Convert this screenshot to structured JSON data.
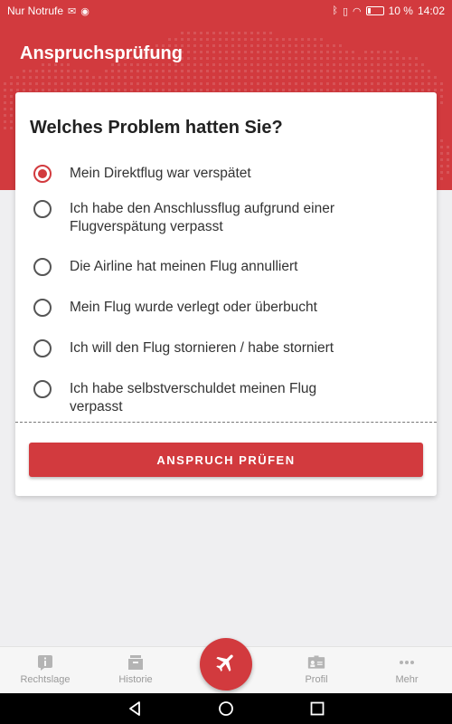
{
  "status_bar": {
    "carrier": "Nur Notrufe",
    "battery": "10 %",
    "time": "14:02"
  },
  "header": {
    "title": "Anspruchsprüfung"
  },
  "card": {
    "title": "Welches Problem hatten Sie?",
    "options": [
      {
        "label": "Mein Direktflug war verspätet",
        "selected": true
      },
      {
        "label": "Ich habe den Anschlussflug aufgrund einer Flugverspätung verpasst",
        "selected": false
      },
      {
        "label": "Die Airline hat meinen Flug annulliert",
        "selected": false
      },
      {
        "label": "Mein Flug wurde verlegt oder überbucht",
        "selected": false
      },
      {
        "label": "Ich will den Flug stornieren / habe storniert",
        "selected": false
      },
      {
        "label": "Ich habe selbstverschuldet meinen Flug verpasst",
        "selected": false
      }
    ],
    "submit_label": "ANSPRUCH PRÜFEN"
  },
  "bottom_nav": {
    "items": [
      {
        "label": "Rechtslage",
        "icon": "info-icon"
      },
      {
        "label": "Historie",
        "icon": "history-icon"
      },
      {
        "label": "",
        "icon": "airplane-icon"
      },
      {
        "label": "Profil",
        "icon": "profile-icon"
      },
      {
        "label": "Mehr",
        "icon": "more-icon"
      }
    ]
  },
  "colors": {
    "brand": "#d23a3e",
    "background": "#efeff1",
    "nav_label": "#9a9a9a"
  }
}
